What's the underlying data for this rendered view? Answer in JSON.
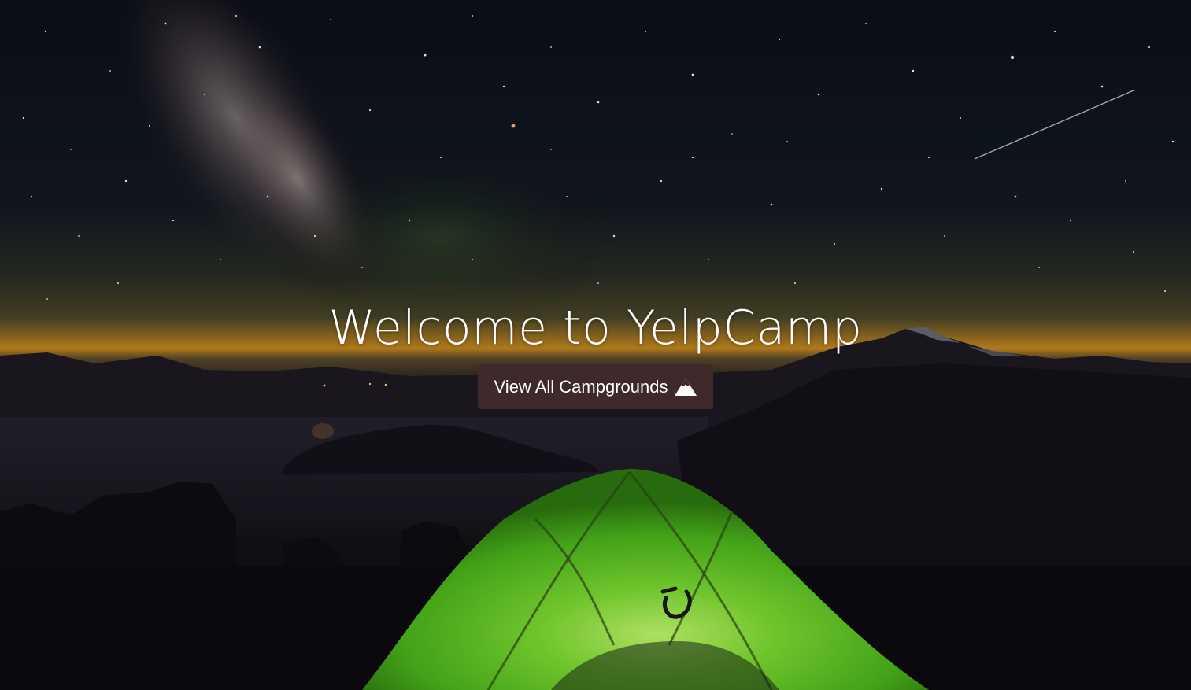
{
  "landing": {
    "title": "Welcome to YelpCamp",
    "button_label": "View All Campgrounds",
    "button_icon": "mountain-icon"
  },
  "colors": {
    "button_bg": "#3e2a2a",
    "text": "#ffffff",
    "tent_green": "#5fd028",
    "sky_top": "#0d1018",
    "horizon_glow": "#f0a020"
  }
}
